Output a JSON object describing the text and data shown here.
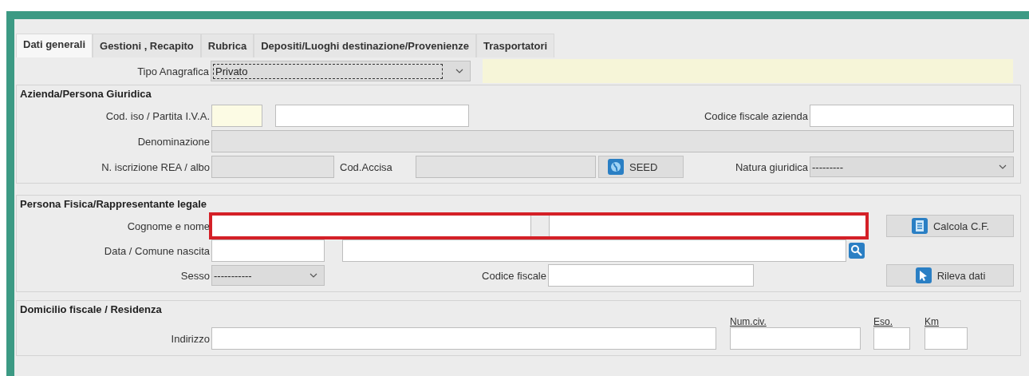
{
  "tabs": [
    {
      "label": "Dati generali",
      "selected": true
    },
    {
      "label": "Gestioni , Recapito",
      "selected": false
    },
    {
      "label": "Rubrica",
      "selected": false
    },
    {
      "label": "Depositi/Luoghi destinazione/Provenienze",
      "selected": false
    },
    {
      "label": "Trasportatori",
      "selected": false
    }
  ],
  "tipo_anagrafica": {
    "label": "Tipo Anagrafica",
    "value": "Privato",
    "focused": true
  },
  "azienda": {
    "title": "Azienda/Persona Giuridica",
    "cod_iso_label": "Cod. iso / Partita I.V.A.",
    "cod_iso_required": true,
    "partita_iva_readonly": false,
    "codice_fiscale_label": "Codice fiscale azienda",
    "codice_fiscale_readonly": false,
    "denominazione_label": "Denominazione",
    "denominazione_readonly": true,
    "rea_label": "N. iscrizione REA / albo",
    "rea_readonly": true,
    "accisa_label": "Cod.Accisa",
    "accisa_readonly": true,
    "seed_button": "SEED",
    "natura_label": "Natura giuridica",
    "natura_value": "---------"
  },
  "persona": {
    "title": "Persona Fisica/Rappresentante legale",
    "cognome_label": "Cognome e nome",
    "cognome_highlighted": true,
    "calcola_button": "Calcola C.F.",
    "nascita_label": "Data / Comune nascita",
    "sesso_label": "Sesso",
    "sesso_value": "-----------",
    "codice_fiscale_label": "Codice fiscale",
    "rileva_button": "Rileva dati"
  },
  "domicilio": {
    "title": "Domicilio fiscale / Residenza",
    "indirizzo_label": "Indirizzo",
    "num_civ_label": "Num.civ.",
    "eso_label": "Eso.",
    "km_label": "Km"
  }
}
